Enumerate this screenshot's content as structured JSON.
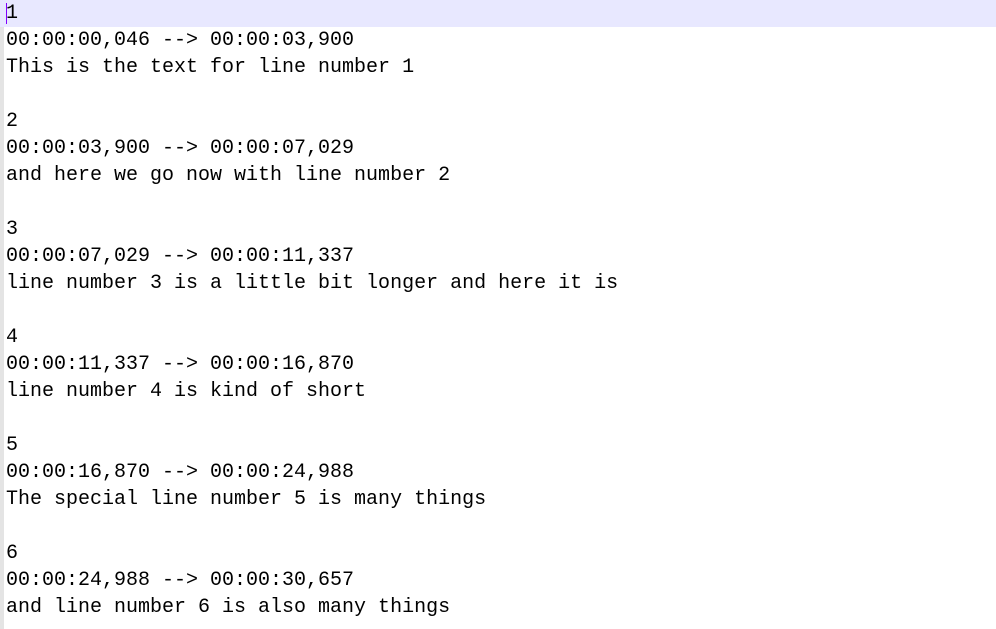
{
  "subtitles": [
    {
      "index": "1",
      "timing": "00:00:00,046 --> 00:00:03,900",
      "text": "This is the text for line number 1"
    },
    {
      "index": "2",
      "timing": "00:00:03,900 --> 00:00:07,029",
      "text": "and here we go now with line number 2"
    },
    {
      "index": "3",
      "timing": "00:00:07,029 --> 00:00:11,337",
      "text": "line number 3 is a little bit longer and here it is"
    },
    {
      "index": "4",
      "timing": "00:00:11,337 --> 00:00:16,870",
      "text": "line number 4 is kind of short"
    },
    {
      "index": "5",
      "timing": "00:00:16,870 --> 00:00:24,988",
      "text": "The special line number 5 is many things"
    },
    {
      "index": "6",
      "timing": "00:00:24,988 --> 00:00:30,657",
      "text": "and line number 6 is also many things"
    }
  ],
  "colors": {
    "current_line_highlight": "#e8e8ff",
    "caret": "#8000ff",
    "text": "#000000",
    "background": "#ffffff"
  }
}
